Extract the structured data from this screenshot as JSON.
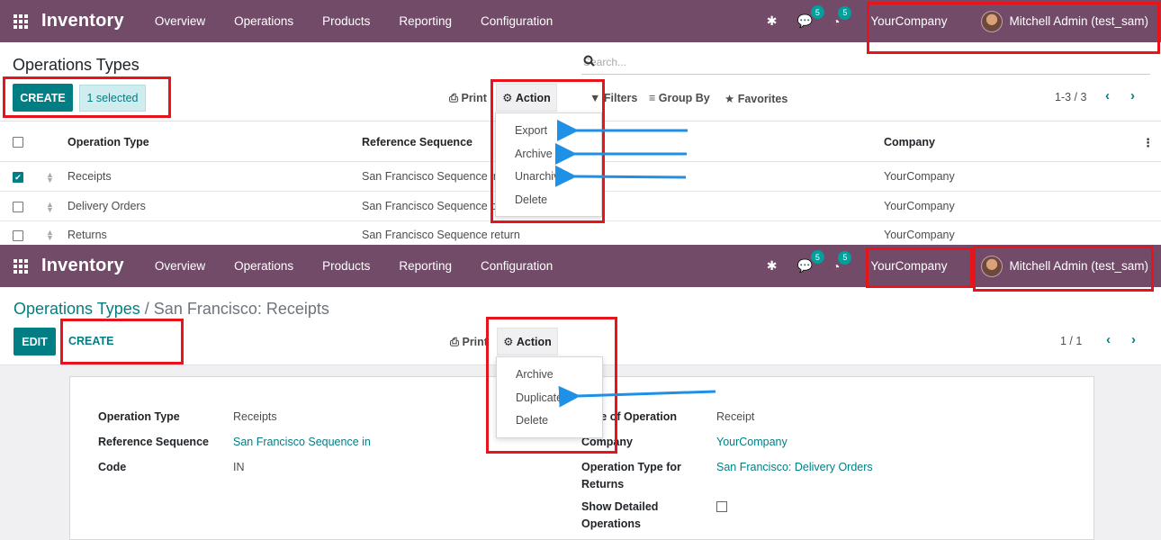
{
  "app": {
    "title": "Inventory",
    "menu": [
      "Overview",
      "Operations",
      "Products",
      "Reporting",
      "Configuration"
    ],
    "company": "YourCompany",
    "user": "Mitchell Admin (test_sam)",
    "messages_count": "5",
    "activities_count": "5"
  },
  "list_view": {
    "title": "Operations Types",
    "search_placeholder": "Search...",
    "create_label": "CREATE",
    "selected_label": "1 selected",
    "print_label": "Print",
    "action_label": "Action",
    "filters_label": "Filters",
    "group_by_label": "Group By",
    "favorites_label": "Favorites",
    "pager": "1-3 / 3",
    "columns": [
      "Operation Type",
      "Reference Sequence",
      "Company"
    ],
    "rows": [
      {
        "operation_type": "Receipts",
        "reference_sequence": "San Francisco Sequence in",
        "company": "YourCompany",
        "checked": true
      },
      {
        "operation_type": "Delivery Orders",
        "reference_sequence": "San Francisco Sequence out",
        "company": "YourCompany",
        "checked": false
      },
      {
        "operation_type": "Returns",
        "reference_sequence": "San Francisco Sequence return",
        "company": "YourCompany",
        "checked": false
      }
    ],
    "action_menu": [
      "Export",
      "Archive",
      "Unarchive",
      "Delete"
    ]
  },
  "form_view": {
    "breadcrumb_parent": "Operations Types",
    "breadcrumb_sep": "/",
    "breadcrumb_current": "San Francisco: Receipts",
    "edit_label": "EDIT",
    "create_label": "CREATE",
    "print_label": "Print",
    "action_label": "Action",
    "pager": "1 / 1",
    "action_menu": [
      "Archive",
      "Duplicate",
      "Delete"
    ],
    "fields_left": [
      {
        "label": "Operation Type",
        "value": "Receipts",
        "link": false
      },
      {
        "label": "Reference Sequence",
        "value": "San Francisco Sequence in",
        "link": true
      },
      {
        "label": "Code",
        "value": "IN",
        "link": false
      }
    ],
    "fields_right": [
      {
        "label": "Type of Operation",
        "value": "Receipt"
      },
      {
        "label": "Company",
        "value": "YourCompany"
      },
      {
        "label": "Operation Type for Returns",
        "value": "San Francisco: Delivery Orders"
      },
      {
        "label": "Show Detailed Operations",
        "value": ""
      }
    ]
  },
  "colors": {
    "navbar": "#714B67",
    "primary": "#017E84",
    "highlight_box": "#E8141B",
    "arrow": "#1E90E6"
  }
}
